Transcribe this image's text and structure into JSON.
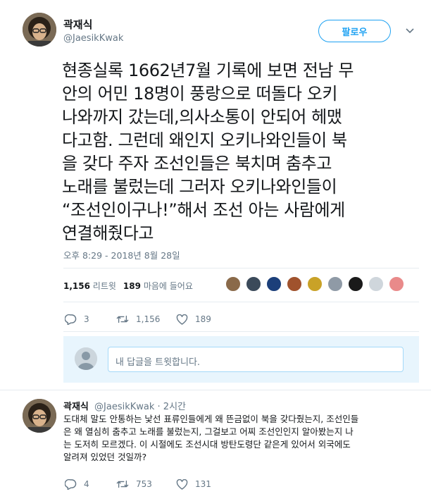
{
  "tweet": {
    "author_name": "곽재식",
    "author_handle": "@JaesikKwak",
    "follow_label": "팔로우",
    "text_lines": [
      "현종실록 1662년7월 기록에 보면 전남 무",
      "안의 어민 18명이 풍랑으로 떠돌다 오키",
      "나와까지 갔는데,의사소통이 안되어 헤맸",
      "다고함. 그런데 왜인지 오키나와인들이 북",
      "을 갖다 주자 조선인들은 북치며 춤추고",
      "노래를 불렀는데 그러자 오키나와인들이",
      "“조선인이구나!”해서 조선 아는 사람에게",
      "연결해줬다고"
    ],
    "timestamp": "오후 8:29 - 2018년 8월 28일",
    "retweets_count": "1,156",
    "retweets_label": "리트윗",
    "likes_count": "189",
    "likes_label": "마음에 들어요",
    "likers": [
      {
        "color": "#8a6a4a",
        "icon": "liker-avatar"
      },
      {
        "color": "#3b4a5a",
        "icon": "liker-avatar"
      },
      {
        "color": "#1c3f7a",
        "icon": "liker-avatar"
      },
      {
        "color": "#a0522d",
        "icon": "liker-avatar"
      },
      {
        "color": "#c9a227",
        "icon": "liker-avatar"
      },
      {
        "color": "#8f9aa6",
        "icon": "liker-avatar"
      },
      {
        "color": "#1a1a1a",
        "icon": "liker-avatar"
      },
      {
        "color": "#cfd6dc",
        "icon": "liker-avatar"
      },
      {
        "color": "#e98a8a",
        "icon": "liker-avatar"
      }
    ],
    "actions": {
      "replies": "3",
      "retweets": "1,156",
      "likes": "189"
    }
  },
  "reply_box": {
    "placeholder": "내 답글을 트윗합니다."
  },
  "reply": {
    "author_name": "곽재식",
    "author_handle": "@JaesikKwak",
    "time": "· 2시간",
    "text_lines": [
      "도대체 말도 안통하는 낯선 표류인들에게 왜 뜬금없이 북을 갖다줬는지, 조선인들",
      "은 왜 열심히 춤추고 노래를 불렀는지, 그걸보고 어찌 조선인인지 알아봤는지 나",
      "는 도저히 모르겠다. 이 시절에도 조선시대 방탄도령단 같은게 있어서 외국에도",
      "알려져 있었던 것일까?"
    ],
    "actions": {
      "replies": "4",
      "retweets": "753",
      "likes": "131"
    }
  },
  "colors": {
    "accent": "#1da1f2",
    "muted": "#657786",
    "text": "#14171a"
  }
}
